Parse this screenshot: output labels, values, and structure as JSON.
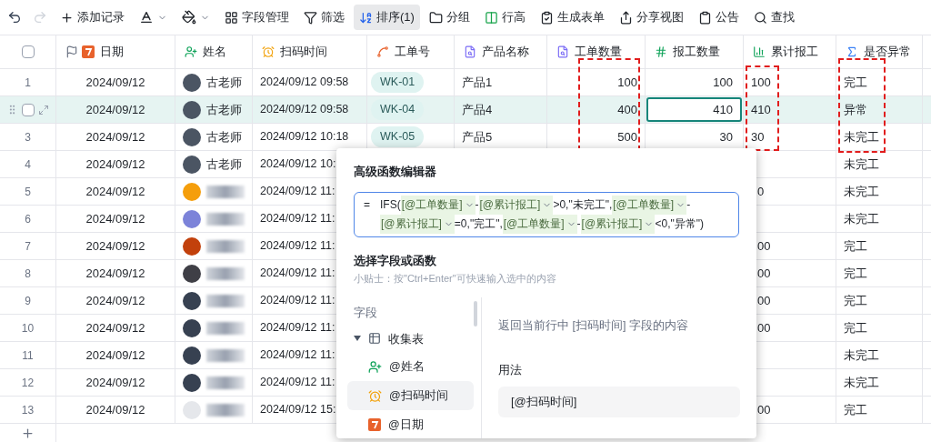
{
  "toolbar": [
    {
      "kind": "undo",
      "disabled": false
    },
    {
      "kind": "redo",
      "disabled": true
    },
    {
      "kind": "add",
      "label": "添加记录",
      "selected": false
    },
    {
      "kind": "text-color",
      "selected": false
    },
    {
      "kind": "fill-color",
      "selected": false
    },
    {
      "kind": "fields",
      "label": "字段管理",
      "selected": false
    },
    {
      "kind": "filter",
      "label": "筛选",
      "selected": false
    },
    {
      "kind": "sort",
      "label": "排序(1)",
      "selected": true
    },
    {
      "kind": "group",
      "label": "分组",
      "selected": false
    },
    {
      "kind": "row-height",
      "label": "行高",
      "selected": false
    },
    {
      "kind": "form",
      "label": "生成表单",
      "selected": false
    },
    {
      "kind": "share",
      "label": "分享视图",
      "selected": false
    },
    {
      "kind": "notice",
      "label": "公告",
      "selected": false
    },
    {
      "kind": "search",
      "label": "查找",
      "selected": false
    }
  ],
  "table": {
    "select_all_checked": false,
    "columns": [
      {
        "kind": "date",
        "label": "日期"
      },
      {
        "kind": "person",
        "label": "姓名"
      },
      {
        "kind": "clock",
        "label": "扫码时间"
      },
      {
        "kind": "link",
        "label": "工单号"
      },
      {
        "kind": "lookup",
        "label": "产品名称"
      },
      {
        "kind": "lookup",
        "label": "工单数量"
      },
      {
        "kind": "number",
        "label": "报工数量"
      },
      {
        "kind": "chart",
        "label": "累计报工"
      },
      {
        "kind": "formula",
        "label": "是否异常"
      }
    ],
    "rows": [
      {
        "index": "1",
        "selected": false,
        "active_cell": false,
        "date": "2024/09/12",
        "name": "古老师",
        "blurred": false,
        "avatar": {
          "color": "#4b5563"
        },
        "time": "2024/09/12 09:58",
        "order": "WK-01",
        "product": "产品1",
        "qty": "100",
        "reported": "100",
        "cumulative": "100",
        "status": "完工"
      },
      {
        "selected": true,
        "active_cell": true,
        "date": "2024/09/12",
        "name": "古老师",
        "blurred": false,
        "avatar": {
          "color": "#4b5563"
        },
        "time": "2024/09/12 09:58",
        "order": "WK-04",
        "product": "产品4",
        "qty": "400",
        "reported": "410",
        "cumulative": "410",
        "status": "异常"
      },
      {
        "index": "3",
        "selected": false,
        "active_cell": false,
        "date": "2024/09/12",
        "name": "古老师",
        "blurred": false,
        "avatar": {
          "color": "#4b5563"
        },
        "time": "2024/09/12 10:18",
        "order": "WK-05",
        "product": "产品5",
        "qty": "500",
        "reported": "30",
        "cumulative": "30",
        "status": "未完工"
      },
      {
        "index": "4",
        "selected": false,
        "date": "2024/09/12",
        "name": "古老师",
        "blurred": false,
        "avatar": {
          "color": "#4b5563"
        },
        "time": "2024/09/12 10:",
        "status": "未完工"
      },
      {
        "index": "5",
        "selected": false,
        "date": "2024/09/12",
        "blurred": true,
        "avatar": {
          "color": "#f59e0b"
        },
        "time": "2024/09/12 11:",
        "cumulative_tail": "0",
        "status": "未完工"
      },
      {
        "index": "6",
        "selected": false,
        "date": "2024/09/12",
        "blurred": true,
        "avatar": {
          "color": "#7c83d9"
        },
        "time": "2024/09/12 11:",
        "status": "未完工"
      },
      {
        "index": "7",
        "selected": false,
        "date": "2024/09/12",
        "blurred": true,
        "avatar": {
          "color": "#c2410c"
        },
        "time": "2024/09/12 11:",
        "cumulative_tail": "00",
        "status": "完工"
      },
      {
        "index": "8",
        "selected": false,
        "date": "2024/09/12",
        "blurred": true,
        "avatar": {
          "color": "#3f3f46"
        },
        "time": "2024/09/12 11:",
        "cumulative_tail": "00",
        "status": "完工"
      },
      {
        "index": "9",
        "selected": false,
        "date": "2024/09/12",
        "blurred": true,
        "avatar": {
          "color": "#374151"
        },
        "time": "2024/09/12 11:",
        "cumulative_tail": "00",
        "status": "完工"
      },
      {
        "index": "10",
        "selected": false,
        "date": "2024/09/12",
        "blurred": true,
        "avatar": {
          "color": "#374151"
        },
        "time": "2024/09/12 11:",
        "cumulative_tail": "00",
        "status": "完工"
      },
      {
        "index": "11",
        "selected": false,
        "date": "2024/09/12",
        "blurred": true,
        "avatar": {
          "color": "#374151"
        },
        "time": "2024/09/12 11:",
        "status": "未完工"
      },
      {
        "index": "12",
        "selected": false,
        "date": "2024/09/12",
        "blurred": true,
        "avatar": {
          "color": "#374151"
        },
        "time": "2024/09/12 11:",
        "status": "未完工"
      },
      {
        "index": "13",
        "selected": false,
        "date": "2024/09/12",
        "blurred": true,
        "avatar": {
          "color": "#e5e7eb"
        },
        "time": "2024/09/12 15:",
        "cumulative_tail": "00",
        "status": "完工"
      }
    ]
  },
  "editor": {
    "title": "高级函数编辑器",
    "prefix": "=",
    "formula": [
      {
        "kind": "text",
        "text": "IFS("
      },
      {
        "kind": "field",
        "text": "[@工单数量]"
      },
      {
        "kind": "text",
        "text": "-"
      },
      {
        "kind": "field",
        "text": "[@累计报工]"
      },
      {
        "kind": "text",
        "text": ">0,\"未完工\","
      },
      {
        "kind": "field",
        "text": "[@工单数量]"
      },
      {
        "kind": "text",
        "text": "-"
      },
      {
        "kind": "field",
        "text": "[@累计报工]"
      },
      {
        "kind": "text",
        "text": "=0,\"完工\","
      },
      {
        "kind": "field",
        "text": "[@工单数量]"
      },
      {
        "kind": "text",
        "text": "-"
      },
      {
        "kind": "field",
        "text": "[@累计报工]"
      },
      {
        "kind": "text",
        "text": "<0,\"异常\")"
      }
    ],
    "section_title": "选择字段或函数",
    "tip": "小贴士：按\"Ctrl+Enter\"可快速输入选中的内容",
    "list_heading": "字段",
    "tree": [
      {
        "label": "收集表",
        "expanded": true,
        "children": [
          {
            "kind": "person",
            "label": "@姓名",
            "selected": false
          },
          {
            "kind": "clock",
            "label": "@扫码时间",
            "selected": true
          },
          {
            "kind": "date",
            "label": "@日期",
            "selected": false
          }
        ]
      }
    ],
    "description": "返回当前行中 [扫码时间] 字段的内容",
    "usage_label": "用法",
    "usage": "[@扫码时间]"
  }
}
